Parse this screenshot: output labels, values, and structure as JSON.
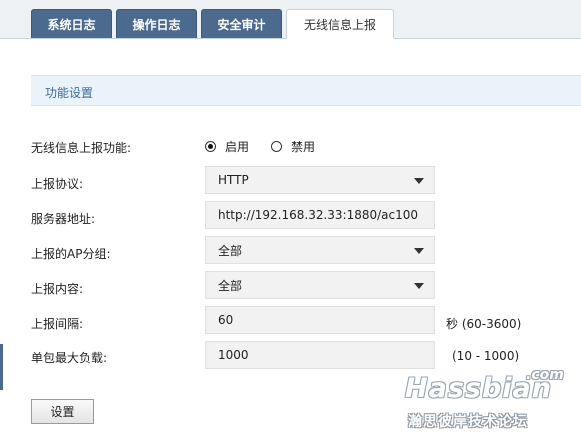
{
  "tabs": [
    {
      "label": "系统日志",
      "active": false
    },
    {
      "label": "操作日志",
      "active": false
    },
    {
      "label": "安全审计",
      "active": false
    },
    {
      "label": "无线信息上报",
      "active": true
    }
  ],
  "section": {
    "title": "功能设置"
  },
  "form": {
    "report_function": {
      "label": "无线信息上报功能:",
      "options": [
        "启用",
        "禁用"
      ],
      "selected": "启用"
    },
    "protocol": {
      "label": "上报协议:",
      "value": "HTTP"
    },
    "server": {
      "label": "服务器地址:",
      "value": "http://192.168.32.33:1880/ac100"
    },
    "ap_group": {
      "label": "上报的AP分组:",
      "value": "全部"
    },
    "content": {
      "label": "上报内容:",
      "value": "全部"
    },
    "interval": {
      "label": "上报间隔:",
      "value": "60",
      "hint": "秒 (60-3600)"
    },
    "max_load": {
      "label": "单包最大负载:",
      "value": "1000",
      "hint": "(10 - 1000)"
    }
  },
  "actions": {
    "submit_label": "设置"
  },
  "watermark": {
    "brand": "Hassbian",
    "domain": ".com",
    "subtitle": "瀚思彼岸技术论坛"
  },
  "colors": {
    "tab_bg": "#4b6a8e",
    "section_bg": "#ebf3fa",
    "field_bg": "#f2f2f2"
  }
}
